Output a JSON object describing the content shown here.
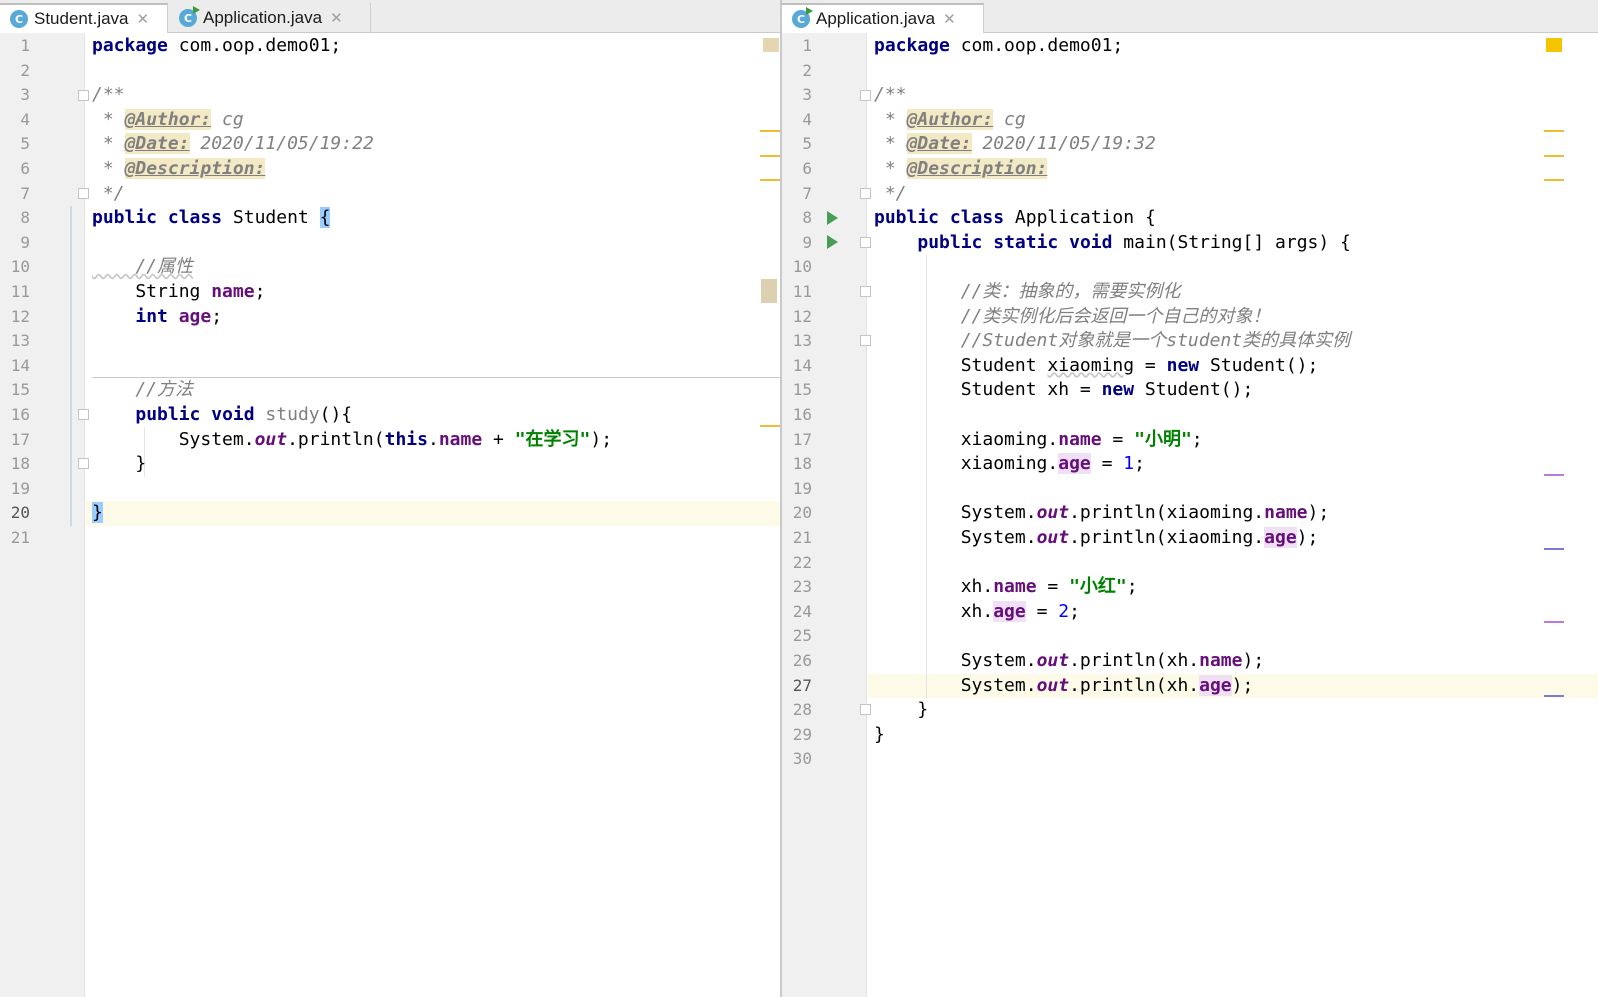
{
  "colors": {
    "keyword": "#000080",
    "comment": "#808080",
    "field": "#660e7a",
    "string": "#008000",
    "number": "#0000ff",
    "current_line": "#fdfbe8",
    "gutter": "#f0f0f0"
  },
  "left_pane": {
    "tabs": [
      {
        "label": "Student.java",
        "icon": "java-class-icon",
        "active": true
      },
      {
        "label": "Application.java",
        "icon": "java-class-run-icon",
        "active": false
      }
    ],
    "line_numbers": [
      "1",
      "2",
      "3",
      "4",
      "5",
      "6",
      "7",
      "8",
      "9",
      "10",
      "11",
      "12",
      "13",
      "14",
      "15",
      "16",
      "17",
      "18",
      "19",
      "20",
      "21"
    ],
    "code": {
      "l1_kw": "package",
      "l1_pkg": " com.oop.demo01;",
      "l3": "/**",
      "l4_star": " * ",
      "l4_tag": "@Author:",
      "l4_val": " cg",
      "l5_star": " * ",
      "l5_tag": "@Date:",
      "l5_val": " 2020/11/05/19:22",
      "l6_star": " * ",
      "l6_tag": "@Description:",
      "l7": " */",
      "l8_kw1": "public",
      "l8_kw2": "class",
      "l8_name": " Student ",
      "l8_brace": "{",
      "l10": "    //属性",
      "l11_type": "    String ",
      "l11_field": "name",
      "l11_end": ";",
      "l12_kw": "int",
      "l12_field": "age",
      "l12_end": ";",
      "l15": "    //方法",
      "l16_kw1": "public",
      "l16_kw2": "void",
      "l16_name": " study",
      "l16_end": "(){",
      "l17_pre": "        System.",
      "l17_out": "out",
      "l17_mid": ".println(",
      "l17_this": "this",
      "l17_dot": ".",
      "l17_field": "name",
      "l17_plus": " + ",
      "l17_str": "\"在学习\"",
      "l17_end": ");",
      "l18": "    }",
      "l20": "}"
    }
  },
  "right_pane": {
    "tabs": [
      {
        "label": "Application.java",
        "icon": "java-class-run-icon",
        "active": true
      }
    ],
    "line_numbers": [
      "1",
      "2",
      "3",
      "4",
      "5",
      "6",
      "7",
      "8",
      "9",
      "10",
      "11",
      "12",
      "13",
      "14",
      "15",
      "16",
      "17",
      "18",
      "19",
      "20",
      "21",
      "22",
      "23",
      "24",
      "25",
      "26",
      "27",
      "28",
      "29",
      "30"
    ],
    "code": {
      "l1_kw": "package",
      "l1_pkg": " com.oop.demo01;",
      "l3": "/**",
      "l4_star": " * ",
      "l4_tag": "@Author:",
      "l4_val": " cg",
      "l5_star": " * ",
      "l5_tag": "@Date:",
      "l5_val": " 2020/11/05/19:32",
      "l6_star": " * ",
      "l6_tag": "@Description:",
      "l7": " */",
      "l8_kw1": "public",
      "l8_kw2": "class",
      "l8_rest": " Application {",
      "l9_kw1": "public",
      "l9_kw2": "static",
      "l9_kw3": "void",
      "l9_rest": " main(String[] args) {",
      "l11": "        //类：抽象的，需要实例化",
      "l12": "        //类实例化后会返回一个自己的对象！",
      "l13": "        //Student对象就是一个student类的具体实例",
      "l14_pre": "        Student ",
      "l14_var": "xiaoming",
      "l14_eq": " = ",
      "l14_kw": "new",
      "l14_rest": " Student();",
      "l15_pre": "        Student xh = ",
      "l15_kw": "new",
      "l15_rest": " Student();",
      "l17_pre": "        xiaoming.",
      "l17_field": "name",
      "l17_eq": " = ",
      "l17_str": "\"小明\"",
      "l17_end": ";",
      "l18_pre": "        xiaoming.",
      "l18_field": "age",
      "l18_eq": " = ",
      "l18_num": "1",
      "l18_end": ";",
      "l20_pre": "        System.",
      "l20_out": "out",
      "l20_mid": ".println(xiaoming.",
      "l20_field": "name",
      "l20_end": ");",
      "l21_pre": "        System.",
      "l21_out": "out",
      "l21_mid": ".println(xiaoming.",
      "l21_field": "age",
      "l21_end": ");",
      "l23_pre": "        xh.",
      "l23_field": "name",
      "l23_eq": " = ",
      "l23_str": "\"小红\"",
      "l23_end": ";",
      "l24_pre": "        xh.",
      "l24_field": "age",
      "l24_eq": " = ",
      "l24_num": "2",
      "l24_end": ";",
      "l26_pre": "        System.",
      "l26_out": "out",
      "l26_mid": ".println(xh.",
      "l26_field": "name",
      "l26_end": ");",
      "l27_pre": "        System.",
      "l27_out": "out",
      "l27_mid": ".println(xh.",
      "l27_field": "age",
      "l27_end": ");",
      "l28": "    }",
      "l29": "}"
    }
  }
}
